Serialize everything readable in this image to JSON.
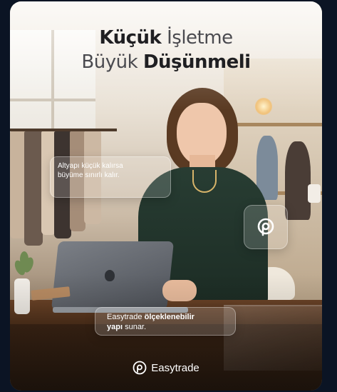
{
  "headline": {
    "line1_bold": "Küçük",
    "line1_light": "İşletme",
    "line2_light": "Büyük",
    "line2_bold": "Düşünmeli"
  },
  "callouts": {
    "top_text": "Altyapı küçük kalırsa büyüme sınırlı kalır.",
    "bottom_plain": "Easytrade",
    "bottom_bold_1": "ölçeklenebilir",
    "bottom_bold_2": "yapı",
    "bottom_tail": "sunar."
  },
  "icon_card": {
    "icon": "easytrade-logo-icon"
  },
  "brand": {
    "logo_icon": "easytrade-logo-icon",
    "name": "Easytrade"
  },
  "colors": {
    "page_background": "#0b1424",
    "headline_text": "#2b2b2e",
    "glass_text": "#ffffff",
    "sweater": "#283d33"
  }
}
